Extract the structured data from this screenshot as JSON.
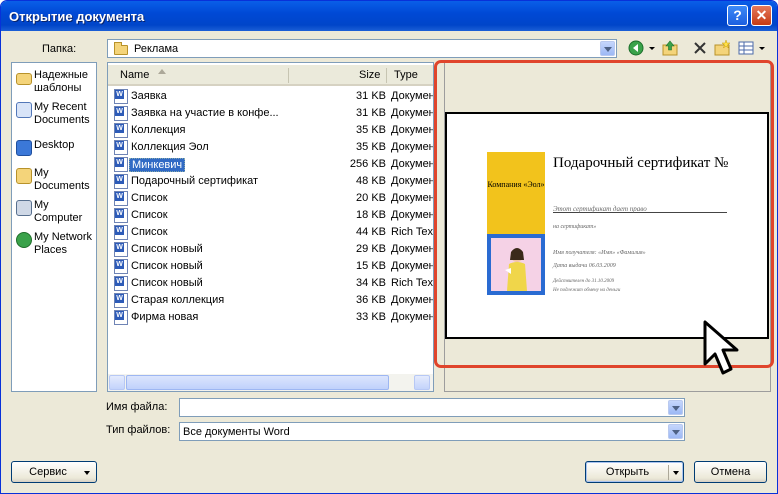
{
  "window": {
    "title": "Открытие документа",
    "help": "?",
    "close": "✕"
  },
  "folder": {
    "label": "Папка:",
    "value": "Реклама"
  },
  "places": [
    {
      "label": "Надежные шаблоны",
      "icon": "folder-icon"
    },
    {
      "label": "My Recent Documents",
      "icon": "recent-documents-icon"
    },
    {
      "label": "Desktop",
      "icon": "desktop-icon"
    },
    {
      "label": "My Documents",
      "icon": "my-documents-icon"
    },
    {
      "label": "My Computer",
      "icon": "my-computer-icon"
    },
    {
      "label": "My Network Places",
      "icon": "network-places-icon"
    }
  ],
  "columns": {
    "name": "Name",
    "size": "Size",
    "type": "Type"
  },
  "files": [
    {
      "name": "Заявка",
      "size": "31 KB",
      "type": "Докумен"
    },
    {
      "name": "Заявка на участие в конфе...",
      "size": "31 KB",
      "type": "Докумен"
    },
    {
      "name": "Коллекция",
      "size": "35 KB",
      "type": "Докумен"
    },
    {
      "name": "Коллекция Эол",
      "size": "35 KB",
      "type": "Докумен"
    },
    {
      "name": "Минкевич",
      "size": "256 KB",
      "type": "Докумен",
      "selected": true
    },
    {
      "name": "Подарочный сертификат",
      "size": "48 KB",
      "type": "Докумен"
    },
    {
      "name": "Список",
      "size": "20 KB",
      "type": "Докумен"
    },
    {
      "name": "Список",
      "size": "18 KB",
      "type": "Докумен"
    },
    {
      "name": "Список",
      "size": "44 KB",
      "type": "Rich Tex"
    },
    {
      "name": "Список новый",
      "size": "29 KB",
      "type": "Докумен"
    },
    {
      "name": "Список новый",
      "size": "15 KB",
      "type": "Докумен"
    },
    {
      "name": "Список новый",
      "size": "34 KB",
      "type": "Rich Tex"
    },
    {
      "name": "Старая коллекция",
      "size": "36 KB",
      "type": "Докумен"
    },
    {
      "name": "Фирма новая",
      "size": "33 KB",
      "type": "Докумен"
    }
  ],
  "preview": {
    "company": "Компания «Эол»",
    "title": "Подарочный сертификат №",
    "lines": [
      "Этот сертификат дает право",
      "на сертификат»",
      "Имя получателя: «Имя» «Фамилия»",
      "Дата выдачи 06.03.2009",
      "Действителен до 31.10.2009",
      "Не подлежит обмену на деньги"
    ]
  },
  "filename": {
    "label": "Имя файла:",
    "value": ""
  },
  "filetype": {
    "label": "Тип файлов:",
    "value": "Все документы Word"
  },
  "buttons": {
    "service": "Сервис",
    "open": "Открыть",
    "cancel": "Отмена"
  },
  "colors": {
    "highlight": "#e0452c",
    "selection": "#316ac5",
    "titlebar": "#0054e3"
  }
}
